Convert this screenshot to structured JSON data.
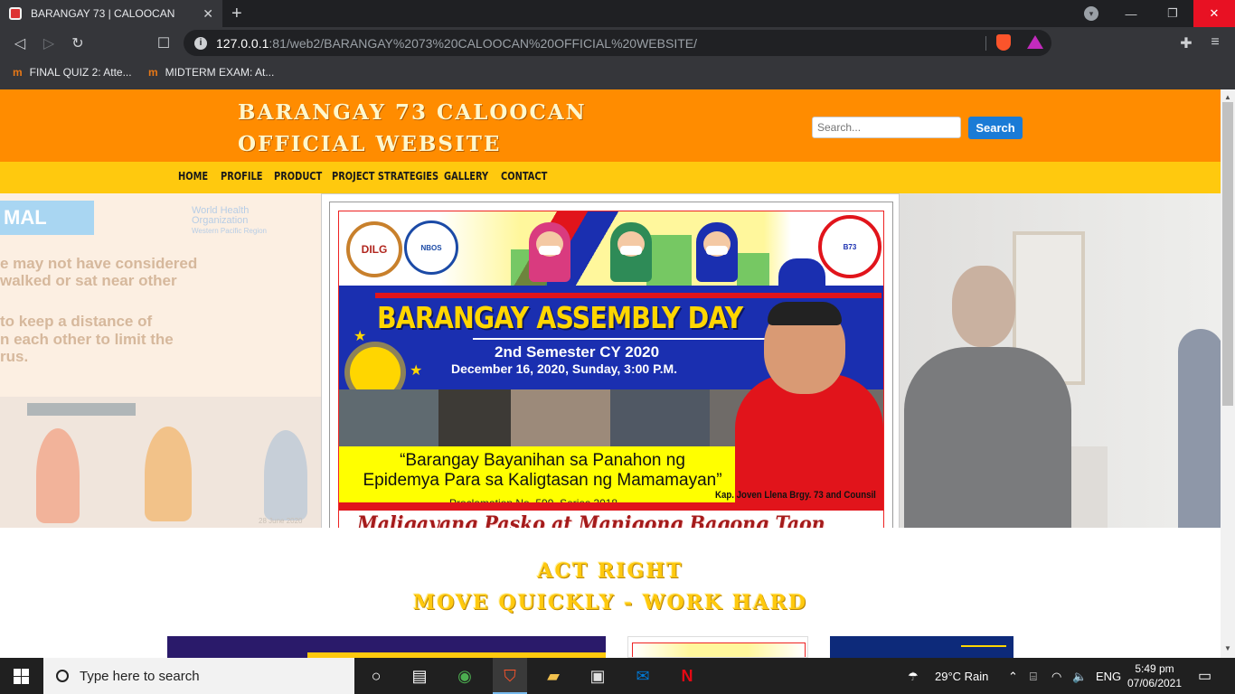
{
  "browser": {
    "tab_title": "BARANGAY 73 | CALOOCAN",
    "tab_close": "✕",
    "new_tab": "+",
    "url_host": "127.0.0.1",
    "url_path": ":81/web2/BARANGAY%2073%20CALOOCAN%20OFFICIAL%20WEBSITE/",
    "bookmarks": [
      {
        "label": "FINAL QUIZ 2: Atte..."
      },
      {
        "label": "MIDTERM EXAM: At..."
      }
    ]
  },
  "site": {
    "title_line1": "BARANGAY 73 CALOOCAN",
    "title_line2": "OFFICIAL WEBSITE",
    "search_placeholder": "Search...",
    "search_button": "Search",
    "nav": [
      "HOME",
      "PROFILE",
      "PRODUCT",
      "PROJECT STRATEGIES",
      "GALLERY",
      "CONTACT"
    ],
    "motto_line1": "ACT RIGHT",
    "motto_line2": "MOVE QUICKLY - WORK HARD"
  },
  "hero_left": {
    "heading_fragment": "MAL",
    "who_line1": "World Health",
    "who_line2": "Organization",
    "who_line3": "Western Pacific Region",
    "lines": [
      "e may not have considered",
      "walked or sat near other",
      "to keep a distance of",
      "n each other to limit the",
      "rus."
    ],
    "date": "28 June 2020"
  },
  "poster": {
    "dilg": "DILG",
    "assembly": "BARANGAY ASSEMBLY DAY",
    "semester": "2nd Semester CY 2020",
    "schedule": "December 16, 2020, Sunday, 3:00 P.M.",
    "slogan_line1": "“Barangay Bayanihan sa Panahon ng",
    "slogan_line2": "Epidemya Para sa Kaligtasan ng Mamamayan”",
    "proclamation": "Proclamation No. 599, Series 2018",
    "kap": "Kap. Joven Llena Brgy. 73 and Counsil",
    "greeting": "Maligayang Pasko at Manigong Bagong Taon"
  },
  "taskbar": {
    "search_placeholder": "Type here to search",
    "weather": "29°C  Rain",
    "lang": "ENG",
    "time": "5:49 pm",
    "date": "07/06/2021"
  },
  "colors": {
    "header": "#ff8c00",
    "nav": "#ffc90e",
    "search_button": "#1a7bd6",
    "motto": "#ffc90e"
  }
}
